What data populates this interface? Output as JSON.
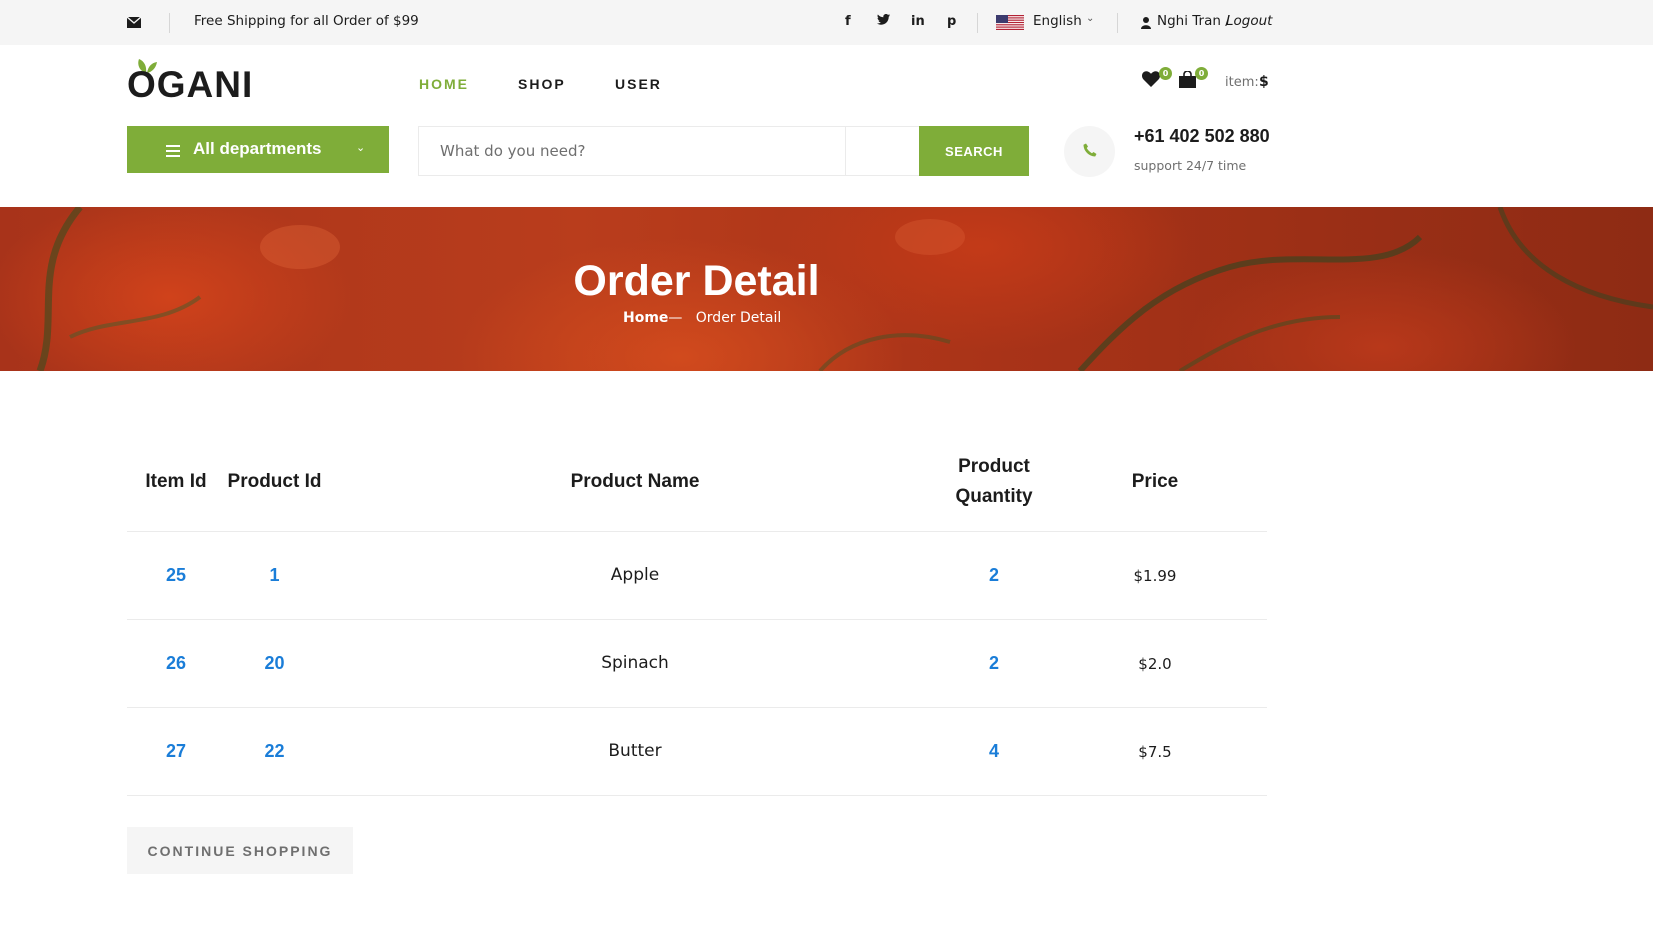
{
  "topbar": {
    "shipping_text": "Free Shipping for all Order of $99",
    "language": "English",
    "user_name": "Nghi Tran /",
    "logout_label": "Logout",
    "social": [
      "f",
      "t",
      "in",
      "p"
    ]
  },
  "header": {
    "logo": "OGANI",
    "nav": [
      {
        "label": "HOME",
        "active": true
      },
      {
        "label": "SHOP",
        "active": false
      },
      {
        "label": "USER",
        "active": false
      }
    ],
    "wishlist_count": "0",
    "cart_count": "0",
    "item_label": "item:",
    "item_price": "$"
  },
  "hero_search": {
    "departments_label": "All departments",
    "search_placeholder": "What do you need?",
    "search_button": "SEARCH",
    "phone": "+61 402 502 880",
    "support": "support 24/7 time"
  },
  "breadcrumb": {
    "title": "Order Detail",
    "home": "Home",
    "separator": "—",
    "current": "Order Detail"
  },
  "order_table": {
    "headers": {
      "item_id": "Item Id",
      "product_id": "Product Id",
      "product_name": "Product Name",
      "quantity_line1": "Product",
      "quantity_line2": "Quantity",
      "price": "Price"
    },
    "rows": [
      {
        "item_id": "25",
        "product_id": "1",
        "product_name": "Apple",
        "quantity": "2",
        "price": "$1.99"
      },
      {
        "item_id": "26",
        "product_id": "20",
        "product_name": "Spinach",
        "quantity": "2",
        "price": "$2.0"
      },
      {
        "item_id": "27",
        "product_id": "22",
        "product_name": "Butter",
        "quantity": "4",
        "price": "$7.5"
      }
    ]
  },
  "actions": {
    "continue_shopping": "CONTINUE SHOPPING"
  },
  "colors": {
    "accent": "#7fad39",
    "link_blue": "#1a7dd8",
    "topbar_bg": "#f5f5f5"
  }
}
